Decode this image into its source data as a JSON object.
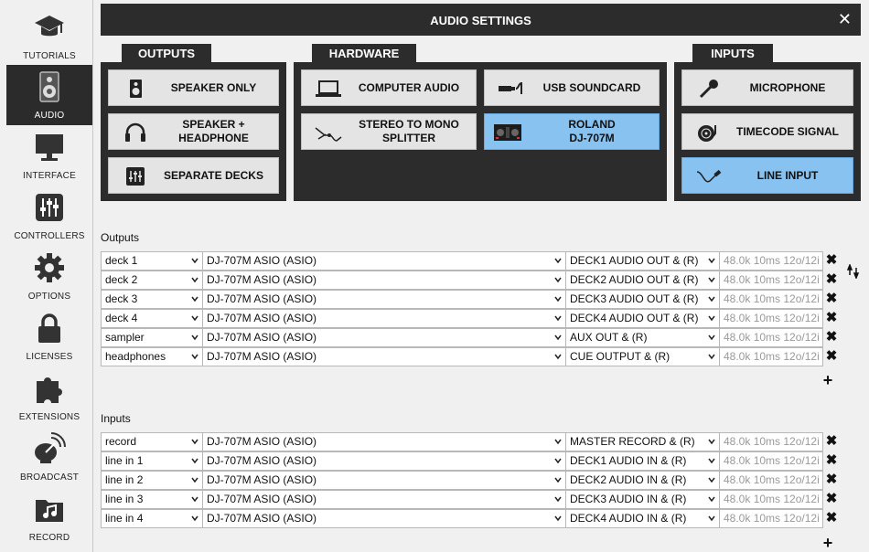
{
  "sidebar": {
    "items": [
      {
        "label": "TUTORIALS",
        "icon": "graduation-cap-icon"
      },
      {
        "label": "AUDIO",
        "icon": "speaker-icon",
        "active": true
      },
      {
        "label": "INTERFACE",
        "icon": "monitor-icon"
      },
      {
        "label": "CONTROLLERS",
        "icon": "sliders-icon"
      },
      {
        "label": "OPTIONS",
        "icon": "gear-icon"
      },
      {
        "label": "LICENSES",
        "icon": "lock-icon"
      },
      {
        "label": "EXTENSIONS",
        "icon": "puzzle-icon"
      },
      {
        "label": "BROADCAST",
        "icon": "satellite-icon"
      },
      {
        "label": "RECORD",
        "icon": "music-folder-icon"
      }
    ]
  },
  "header": {
    "title": "AUDIO SETTINGS",
    "close": "✕"
  },
  "groups": {
    "outputs": {
      "label": "OUTPUTS",
      "buttons": [
        {
          "label": "SPEAKER ONLY"
        },
        {
          "label": "SPEAKER +\nHEADPHONE"
        },
        {
          "label": "SEPARATE DECKS"
        }
      ]
    },
    "hardware": {
      "label": "HARDWARE",
      "buttons": [
        {
          "label": "COMPUTER AUDIO"
        },
        {
          "label": "USB SOUNDCARD"
        },
        {
          "label": "STEREO TO MONO\nSPLITTER"
        },
        {
          "label": "ROLAND\nDJ-707M",
          "selected": true
        }
      ]
    },
    "inputs": {
      "label": "INPUTS",
      "buttons": [
        {
          "label": "MICROPHONE"
        },
        {
          "label": "TIMECODE SIGNAL"
        },
        {
          "label": "LINE INPUT",
          "selected": true
        }
      ]
    }
  },
  "outputs_table": {
    "title": "Outputs",
    "rows": [
      {
        "name": "deck 1",
        "device": "DJ-707M ASIO (ASIO)",
        "channel": "DECK1 AUDIO OUT & (R)",
        "info": "48.0k 10ms 12o/12i"
      },
      {
        "name": "deck 2",
        "device": "DJ-707M ASIO (ASIO)",
        "channel": "DECK2 AUDIO OUT & (R)",
        "info": "48.0k 10ms 12o/12i"
      },
      {
        "name": "deck 3",
        "device": "DJ-707M ASIO (ASIO)",
        "channel": "DECK3 AUDIO OUT & (R)",
        "info": "48.0k 10ms 12o/12i"
      },
      {
        "name": "deck 4",
        "device": "DJ-707M ASIO (ASIO)",
        "channel": "DECK4 AUDIO OUT & (R)",
        "info": "48.0k 10ms 12o/12i"
      },
      {
        "name": "sampler",
        "device": "DJ-707M ASIO (ASIO)",
        "channel": "AUX OUT & (R)",
        "info": "48.0k 10ms 12o/12i"
      },
      {
        "name": "headphones",
        "device": "DJ-707M ASIO (ASIO)",
        "channel": "CUE OUTPUT & (R)",
        "info": "48.0k 10ms 12o/12i"
      }
    ]
  },
  "inputs_table": {
    "title": "Inputs",
    "rows": [
      {
        "name": "record",
        "device": "DJ-707M ASIO (ASIO)",
        "channel": "MASTER RECORD & (R)",
        "info": "48.0k 10ms 12o/12i"
      },
      {
        "name": "line in 1",
        "device": "DJ-707M ASIO (ASIO)",
        "channel": "DECK1 AUDIO IN & (R)",
        "info": "48.0k 10ms 12o/12i"
      },
      {
        "name": "line in 2",
        "device": "DJ-707M ASIO (ASIO)",
        "channel": "DECK2 AUDIO IN & (R)",
        "info": "48.0k 10ms 12o/12i"
      },
      {
        "name": "line in 3",
        "device": "DJ-707M ASIO (ASIO)",
        "channel": "DECK3 AUDIO IN & (R)",
        "info": "48.0k 10ms 12o/12i"
      },
      {
        "name": "line in 4",
        "device": "DJ-707M ASIO (ASIO)",
        "channel": "DECK4 AUDIO IN & (R)",
        "info": "48.0k 10ms 12o/12i"
      }
    ]
  },
  "symbols": {
    "delete": "✖",
    "add": "+"
  },
  "colors": {
    "panel": "#2c2c2c",
    "selected": "#87c2f0",
    "button": "#e4e4e4"
  }
}
